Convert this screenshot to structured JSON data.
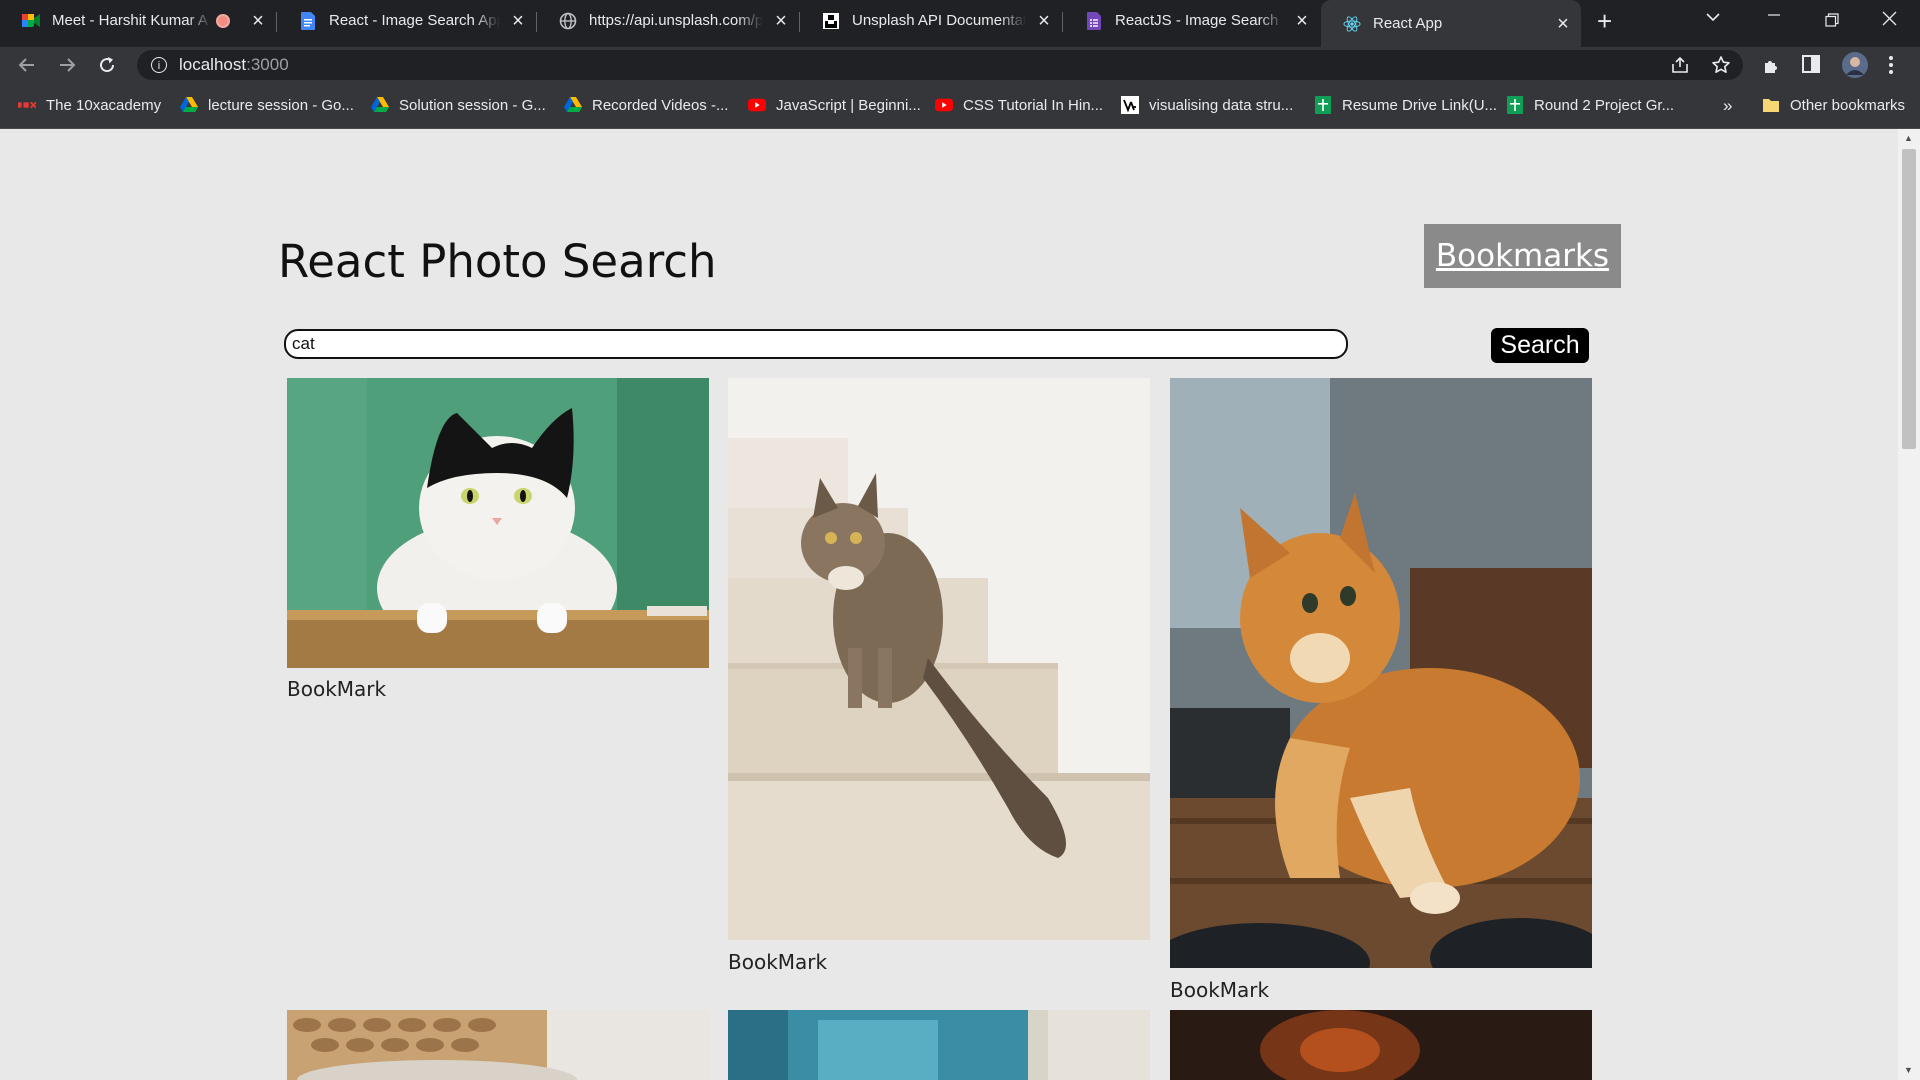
{
  "browser": {
    "tabs": [
      {
        "title": "Meet - Harshit Kumar A",
        "icon": "google-meet-icon",
        "recording": true
      },
      {
        "title": "React - Image Search App -",
        "icon": "google-docs-icon"
      },
      {
        "title": "https://api.unsplash.com/ph",
        "icon": "globe-icon"
      },
      {
        "title": "Unsplash API Documentatio",
        "icon": "unsplash-icon"
      },
      {
        "title": "ReactJS - Image Search App",
        "icon": "google-forms-icon"
      },
      {
        "title": "React App",
        "icon": "react-icon",
        "active": true
      }
    ],
    "address": {
      "host": "localhost",
      "port": ":3000"
    },
    "bookmarks": [
      {
        "label": "The 10xacademy",
        "icon": "10x-icon"
      },
      {
        "label": "lecture session - Go...",
        "icon": "google-drive-icon"
      },
      {
        "label": "Solution session - G...",
        "icon": "google-drive-icon"
      },
      {
        "label": "Recorded Videos -...",
        "icon": "google-drive-icon"
      },
      {
        "label": "JavaScript | Beginni...",
        "icon": "youtube-icon"
      },
      {
        "label": "CSS Tutorial In Hin...",
        "icon": "youtube-icon"
      },
      {
        "label": "visualising data stru...",
        "icon": "visualgo-icon"
      },
      {
        "label": "Resume Drive Link(U...",
        "icon": "google-sheets-icon"
      },
      {
        "label": "Round 2 Project Gr...",
        "icon": "google-sheets-icon"
      }
    ],
    "overflow": "»",
    "other_bookmarks": "Other bookmarks"
  },
  "app": {
    "title": "React Photo Search",
    "bookmarks_button": "Bookmarks",
    "search": {
      "value": "cat",
      "button": "Search"
    },
    "results": [
      {
        "bookmark_label": "BookMark",
        "image": "cat-black-white-green-wall"
      },
      {
        "bookmark_label": "BookMark",
        "image": "tabby-cat-on-stairs"
      },
      {
        "bookmark_label": "BookMark",
        "image": "orange-cat-on-table"
      },
      {
        "image": "cat-wicker-basket"
      },
      {
        "image": "cat-blue-window"
      },
      {
        "image": "cat-dark-orange-bokeh"
      }
    ]
  },
  "colors": {
    "page_bg": "#e8e8e8",
    "bookmarks_btn_bg": "#8a8a8a",
    "search_btn_bg": "#000000"
  }
}
